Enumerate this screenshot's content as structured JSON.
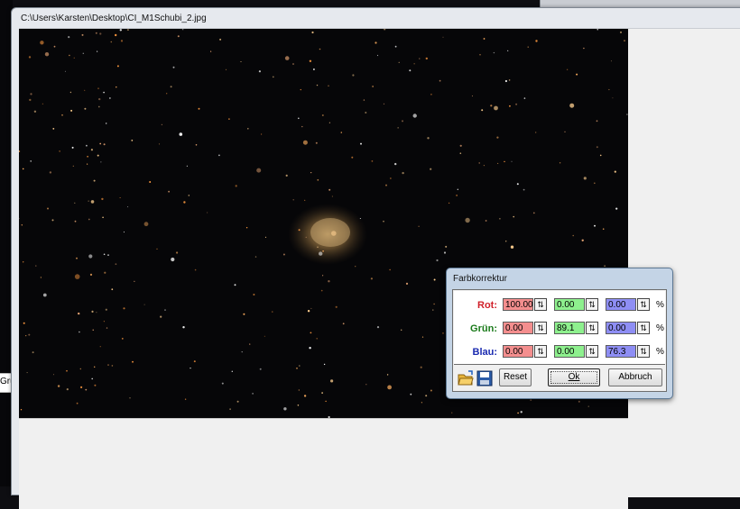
{
  "window": {
    "title": "C:\\Users\\Karsten\\Desktop\\CI_M1Schubi_2.jpg"
  },
  "background": {
    "partial_label": "Grü"
  },
  "dialog": {
    "title": "Farbkorrektur",
    "rows": [
      {
        "label": "Rot:",
        "color": "#d0202a",
        "values": [
          "100.00",
          "0.00",
          "0.00"
        ]
      },
      {
        "label": "Grün:",
        "color": "#1a7a1a",
        "values": [
          "0.00",
          "89.1",
          "0.00"
        ]
      },
      {
        "label": "Blau:",
        "color": "#1a2ab0",
        "values": [
          "0.00",
          "0.00",
          "76.3"
        ]
      }
    ],
    "unit": "%",
    "field_colors": [
      "#f48e8e",
      "#8ef08e",
      "#8e8ef4"
    ],
    "buttons": {
      "open_icon": "folder-open-icon",
      "save_icon": "floppy-disk-icon",
      "reset": "Reset",
      "ok": "Ok",
      "cancel": "Abbruch"
    }
  }
}
